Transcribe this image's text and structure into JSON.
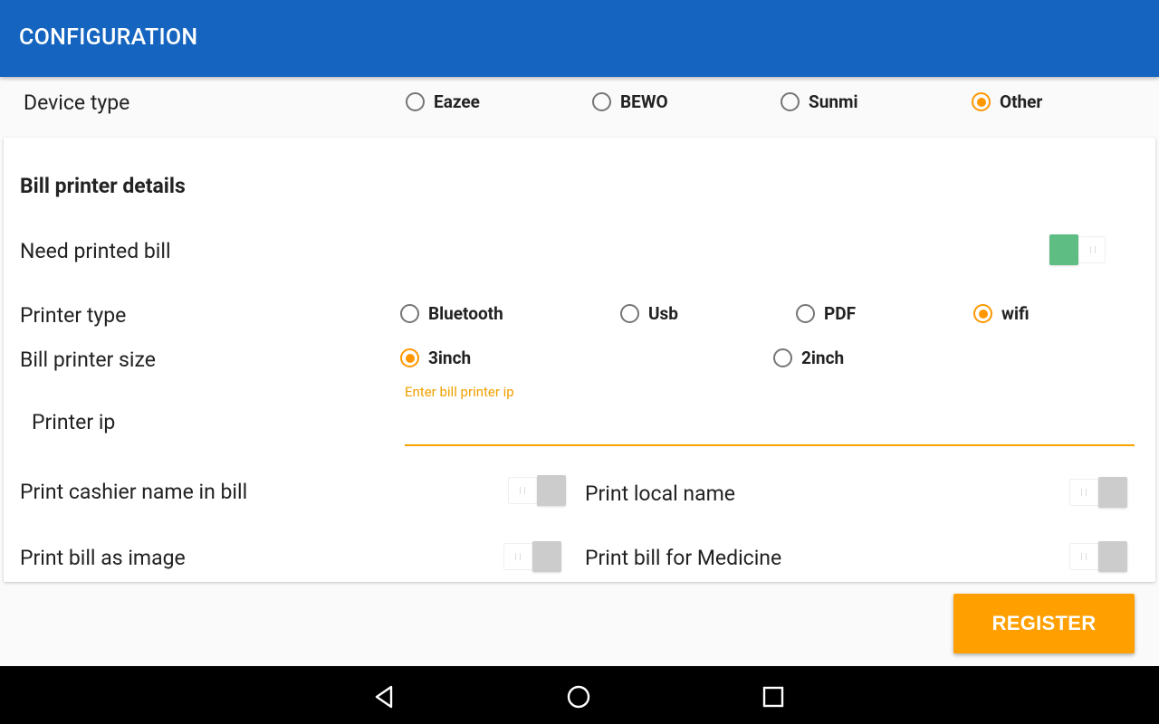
{
  "appbar": {
    "title": "CONFIGURATION"
  },
  "device_type": {
    "label": "Device type",
    "options": [
      "Eazee",
      "BEWO",
      "Sunmi",
      "Other"
    ],
    "selected": "Other"
  },
  "bill_printer": {
    "section_title": "Bill printer details",
    "need_printed_bill": {
      "label": "Need printed bill",
      "on": true
    },
    "printer_type": {
      "label": "Printer type",
      "options": [
        "Bluetooth",
        "Usb",
        "PDF",
        "wifi"
      ],
      "selected": "wifi"
    },
    "printer_size": {
      "label": "Bill printer size",
      "options": [
        "3inch",
        "2inch"
      ],
      "selected": "3inch"
    },
    "printer_ip": {
      "label": "Printer ip",
      "hint": "Enter bill printer ip",
      "value": ""
    },
    "toggles": {
      "cashier_name": {
        "label": "Print cashier name in bill",
        "on": false
      },
      "local_name": {
        "label": "Print local name",
        "on": false
      },
      "bill_as_image": {
        "label": "Print bill as image",
        "on": false
      },
      "bill_for_medicine": {
        "label": "Print bill for Medicine",
        "on": false
      }
    }
  },
  "register_button": {
    "label": "REGISTER"
  },
  "colors": {
    "appbar": "#1565c0",
    "accent": "#ff9800",
    "switch_on": "#5ebd83",
    "switch_off": "#cccccc"
  },
  "nav_icons": [
    "back-icon",
    "home-icon",
    "recents-icon"
  ]
}
